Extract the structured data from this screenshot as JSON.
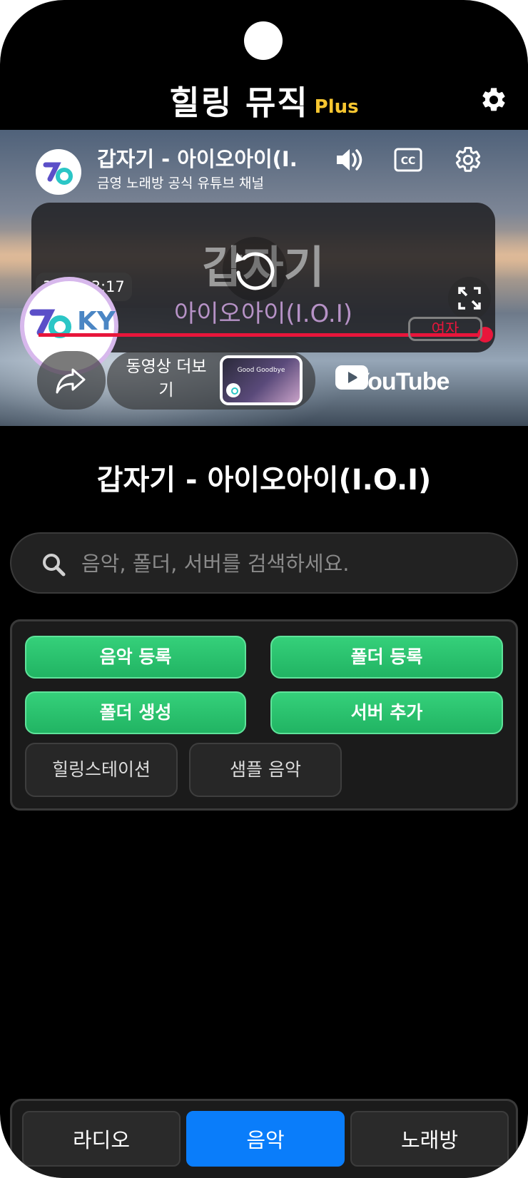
{
  "header": {
    "title": "힐링 뮤직",
    "plus_label": "Plus",
    "settings_icon": "gear-icon"
  },
  "player": {
    "video_title": "갑자기 - 아이오아이(I.O.I)",
    "channel_name": "금영 노래방 공식 유튜브 채널",
    "overlay_song": "갑자기",
    "overlay_artist": "아이오아이(I.O.I)",
    "time": "3:17 / 3:17",
    "progress": 1.0,
    "badge_text": "KY",
    "tag": "여자",
    "more_videos_label": "동영상 더보기",
    "thumbnail_title": "Good Goodbye",
    "youtube_label": "YouTube",
    "progress_color": "#e8163b"
  },
  "now_playing": {
    "title": "갑자기 - 아이오아이(I.O.I)"
  },
  "search": {
    "placeholder": "음악, 폴더, 서버를 검색하세요."
  },
  "actions": {
    "register_music": "음악 등록",
    "register_folder": "폴더 등록",
    "create_folder": "폴더 생성",
    "add_server": "서버 추가",
    "healing_station": "힐링스테이션",
    "sample_music": "샘플 음악",
    "accent_green": "#27c26c"
  },
  "nav": {
    "tabs": [
      {
        "label": "라디오",
        "active": false
      },
      {
        "label": "음악",
        "active": true
      },
      {
        "label": "노래방",
        "active": false
      }
    ],
    "active_color": "#0a7dfa"
  }
}
